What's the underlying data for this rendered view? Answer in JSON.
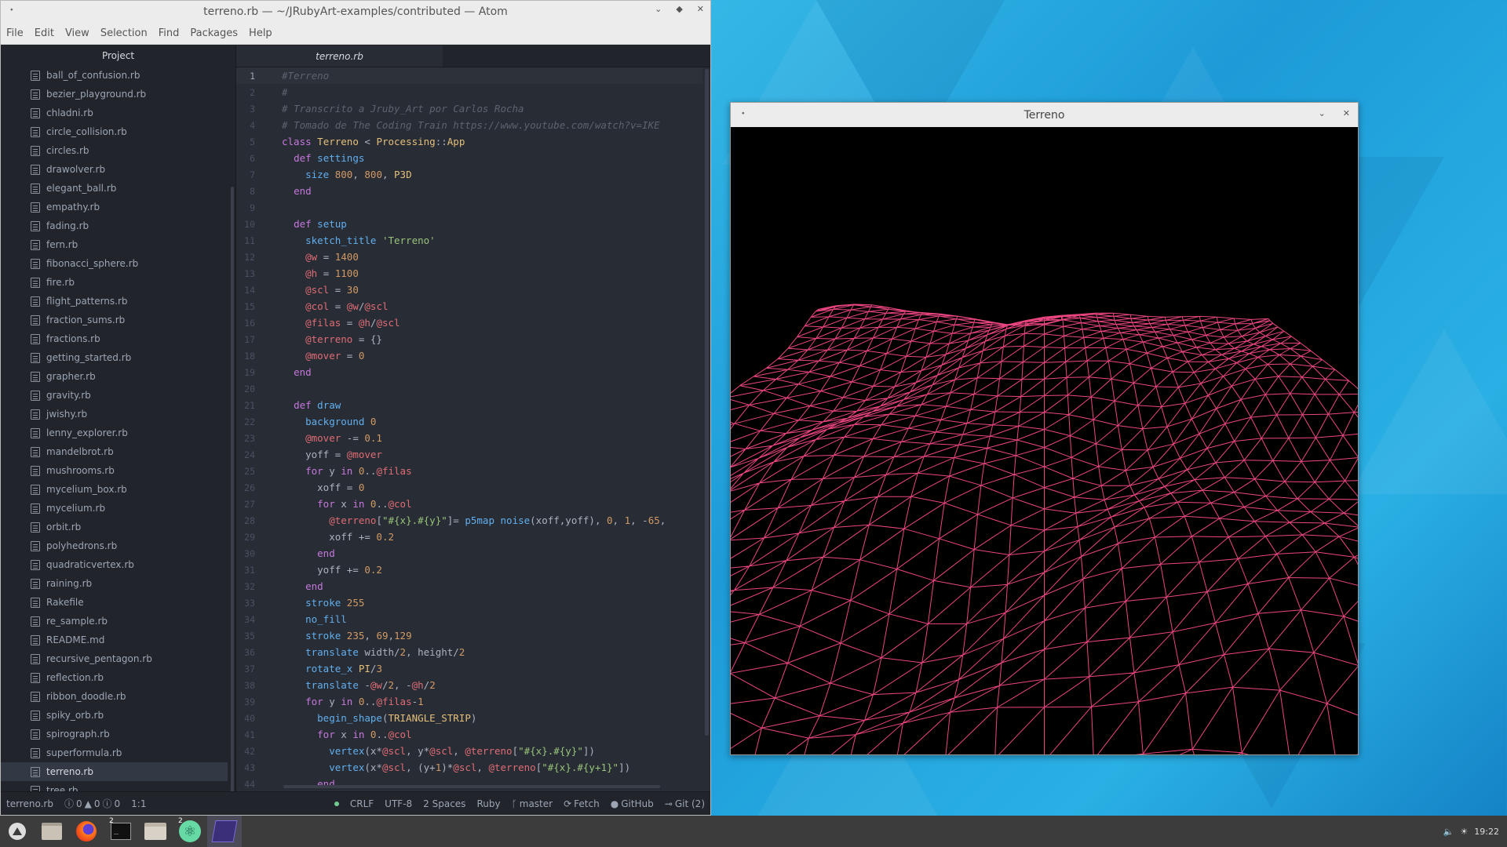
{
  "atom": {
    "title": "terreno.rb — ~/JRubyArt-examples/contributed — Atom",
    "menu": [
      "File",
      "Edit",
      "View",
      "Selection",
      "Find",
      "Packages",
      "Help"
    ],
    "project_header": "Project",
    "tab_label": "terreno.rb",
    "files": [
      "ball_of_confusion.rb",
      "bezier_playground.rb",
      "chladni.rb",
      "circle_collision.rb",
      "circles.rb",
      "drawolver.rb",
      "elegant_ball.rb",
      "empathy.rb",
      "fading.rb",
      "fern.rb",
      "fibonacci_sphere.rb",
      "fire.rb",
      "flight_patterns.rb",
      "fraction_sums.rb",
      "fractions.rb",
      "getting_started.rb",
      "grapher.rb",
      "gravity.rb",
      "jwishy.rb",
      "lenny_explorer.rb",
      "mandelbrot.rb",
      "mushrooms.rb",
      "mycelium_box.rb",
      "mycelium.rb",
      "orbit.rb",
      "polyhedrons.rb",
      "quadraticvertex.rb",
      "raining.rb",
      "Rakefile",
      "re_sample.rb",
      "README.md",
      "recursive_pentagon.rb",
      "reflection.rb",
      "ribbon_doodle.rb",
      "spiky_orb.rb",
      "spirograph.rb",
      "superformula.rb",
      "terreno.rb",
      "tree.rb"
    ],
    "selected_file": "terreno.rb",
    "code_lines": [
      "#Terreno",
      "#",
      "# Transcrito a Jruby_Art por Carlos Rocha",
      "# Tomado de The Coding Train https://www.youtube.com/watch?v=IKE",
      "class Terreno < Processing::App",
      "  def settings",
      "    size 800, 800, P3D",
      "  end",
      "",
      "  def setup",
      "    sketch_title 'Terreno'",
      "    @w = 1400",
      "    @h = 1100",
      "    @scl = 30",
      "    @col = @w/@scl",
      "    @filas = @h/@scl",
      "    @terreno = {}",
      "    @mover = 0",
      "  end",
      "",
      "  def draw",
      "    background 0",
      "    @mover -= 0.1",
      "    yoff = @mover",
      "    for y in 0..@filas",
      "      xoff = 0",
      "      for x in 0..@col",
      "        @terreno[\"#{x}.#{y}\"]= p5map noise(xoff,yoff), 0, 1, -65,",
      "        xoff += 0.2",
      "      end",
      "      yoff += 0.2",
      "    end",
      "    stroke 255",
      "    no_fill",
      "    stroke 235, 69,129",
      "    translate width/2, height/2",
      "    rotate_x PI/3",
      "    translate -@w/2, -@h/2",
      "    for y in 0..@filas-1",
      "      begin_shape(TRIANGLE_STRIP)",
      "      for x in 0..@col",
      "        vertex(x*@scl, y*@scl, @terreno[\"#{x}.#{y}\"])",
      "        vertex(x*@scl, (y+1)*@scl, @terreno[\"#{x}.#{y+1}\"])",
      "      end"
    ],
    "status_left": {
      "file": "terreno.rb",
      "errors": "0",
      "warnings": "0",
      "infos": "0",
      "cursor": "1:1"
    },
    "status_right": {
      "line_ending": "CRLF",
      "encoding": "UTF-8",
      "indent": "2 Spaces",
      "grammar": "Ruby",
      "branch": "master",
      "fetch": "Fetch",
      "github": "GitHub",
      "git": "Git (2)"
    }
  },
  "terreno": {
    "title": "Terreno",
    "stroke_color": "#eb4581",
    "background": "#000000"
  },
  "taskbar": {
    "apps": [
      "system-menu-icon",
      "file-manager-icon",
      "firefox-icon",
      "terminal-icon",
      "folder-icon",
      "atom-icon",
      "terreno-sketch-icon"
    ],
    "terminal_badge": "2",
    "atom_badge": "2",
    "clock": "19:22"
  },
  "colors": {
    "accent": "#eb4581",
    "editor_bg": "#282c34",
    "tree_bg": "#21252b"
  }
}
